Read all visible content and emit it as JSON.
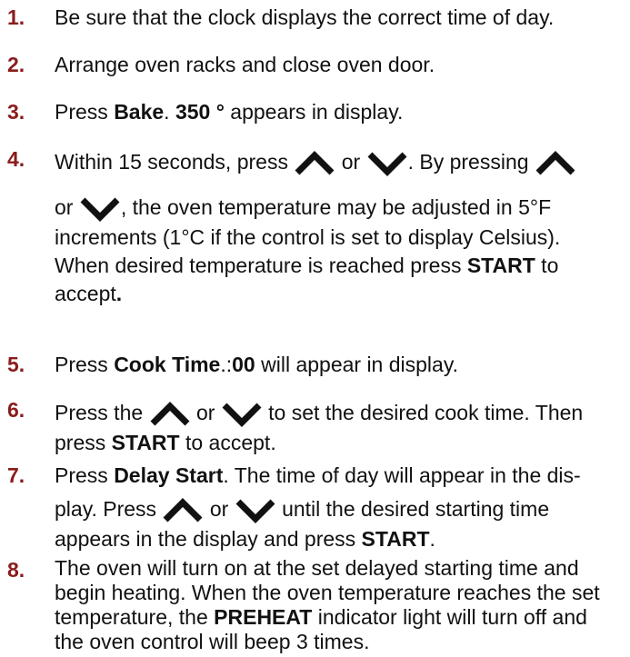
{
  "steps": [
    {
      "number": "1.",
      "lines": [
        [
          "Be sure that the clock displays the correct time of day."
        ]
      ]
    },
    {
      "number": "2.",
      "lines": [
        [
          "Arrange oven racks and close oven door."
        ]
      ]
    },
    {
      "number": "3.",
      "lines": [
        [
          "Press ",
          "Bake",
          ". ",
          "350 °",
          " appears in display."
        ]
      ]
    },
    {
      "number": "4.",
      "lines": [
        [
          "Within 15 seconds, press ",
          "or",
          ". By pressing"
        ],
        [
          "or",
          ", the oven temperature may be adjusted in 5°F"
        ],
        [
          "increments (1°C if the control is set to display Celsius)."
        ],
        [
          "When desired temperature is reached press ",
          "START",
          " to"
        ],
        [
          "accept",
          "."
        ]
      ]
    },
    {
      "number": "5.",
      "lines": [
        [
          "Press ",
          "Cook Time",
          ".:",
          "00",
          " will appear in display."
        ]
      ]
    },
    {
      "number": "6.",
      "lines": [
        [
          "Press the ",
          "or",
          "to set the desired cook time. Then"
        ],
        [
          "press ",
          "START",
          " to accept."
        ]
      ]
    },
    {
      "number": "7.",
      "lines": [
        [
          "Press ",
          "Delay Start",
          ". The time of day will appear in the dis-"
        ],
        [
          "play. Press ",
          "or",
          "until the desired starting time"
        ],
        [
          "appears in the display and press ",
          "START",
          "."
        ]
      ]
    },
    {
      "number": "8.",
      "lines": [
        [
          "The oven will turn on at the set delayed starting time and"
        ],
        [
          "begin heating. When the oven temperature reaches the set"
        ],
        [
          "temperature, the ",
          "PREHEAT",
          " indicator light will turn off and"
        ],
        [
          "the oven control will beep 3 times."
        ]
      ]
    }
  ],
  "icons": {
    "up": "up-arrow-icon",
    "down": "down-arrow-icon",
    "color": "#111111"
  },
  "colors": {
    "text": "#111111",
    "step_number": "#8a1c1c"
  }
}
